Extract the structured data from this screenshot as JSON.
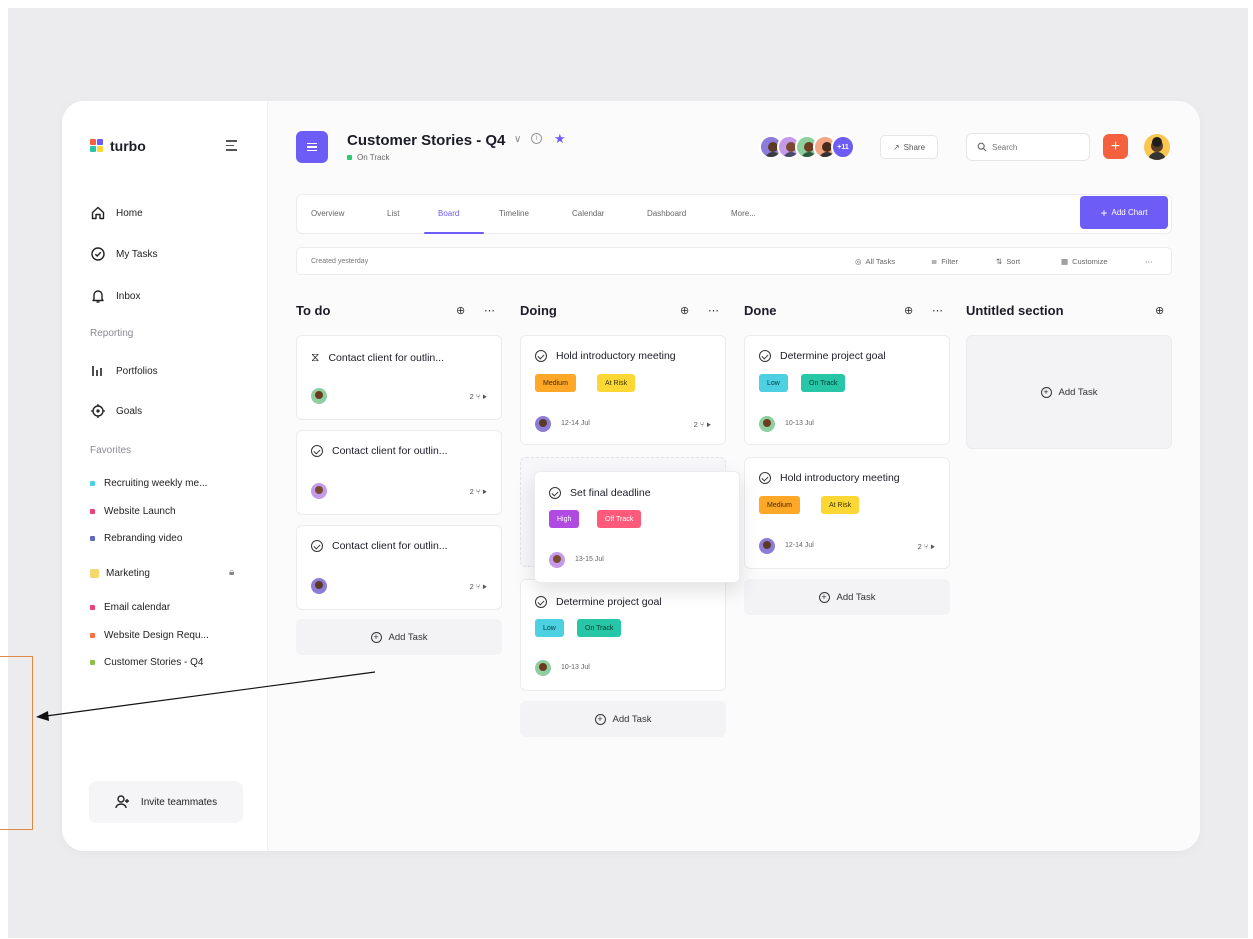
{
  "brand": {
    "name": "turbo"
  },
  "sidebar": {
    "nav": [
      {
        "label": "Home",
        "icon": "home-icon"
      },
      {
        "label": "My Tasks",
        "icon": "check-circle-icon"
      },
      {
        "label": "Inbox",
        "icon": "bell-icon"
      }
    ],
    "reporting_label": "Reporting",
    "reporting": [
      {
        "label": "Portfolios",
        "icon": "bar-chart-icon"
      },
      {
        "label": "Goals",
        "icon": "target-icon"
      }
    ],
    "favorites_label": "Favorites",
    "favorites": [
      {
        "label": "Recruiting weekly me...",
        "color": "#4dd0e1"
      },
      {
        "label": "Website Launch",
        "color": "#ec407a"
      },
      {
        "label": "Rebranding video",
        "color": "#5c6bc0"
      }
    ],
    "folder": {
      "label": "Marketing",
      "color": "#f5d76e"
    },
    "folder_items": [
      {
        "label": "Email calendar",
        "color": "#ec407a"
      },
      {
        "label": "Website Design Requ...",
        "color": "#ff7043"
      },
      {
        "label": "Customer Stories - Q4",
        "color": "#8bc34a"
      }
    ],
    "invite_label": "Invite teammates"
  },
  "header": {
    "title": "Customer Stories - Q4",
    "status": "On Track",
    "status_color": "#2ecc71",
    "avatar_count": "+11",
    "share_label": "Share",
    "search_placeholder": "Search"
  },
  "tabs": [
    "Overview",
    "List",
    "Board",
    "Timeline",
    "Calendar",
    "Dashboard",
    "More..."
  ],
  "active_tab": "Board",
  "add_chart_label": "Add Chart",
  "filter_bar": {
    "created": "Created yesterday",
    "all_tasks": "All Tasks",
    "filter": "Filter",
    "sort": "Sort",
    "customize": "Customize"
  },
  "columns": {
    "todo": {
      "title": "To do",
      "cards": [
        {
          "title": "Contact client for outlin...",
          "meta": "2",
          "icon": "hourglass-icon"
        },
        {
          "title": "Contact client for outlin...",
          "meta": "2"
        },
        {
          "title": "Contact client for outlin...",
          "meta": "2"
        }
      ]
    },
    "doing": {
      "title": "Doing",
      "cards": [
        {
          "title": "Hold introductory meeting",
          "tags": [
            "Medium",
            "At Risk"
          ],
          "date": "12-14 Jul",
          "meta": "2"
        },
        {
          "title": "Set final deadline",
          "tags": [
            "High",
            "Off Track"
          ],
          "date": "13-15 Jul"
        },
        {
          "title": "Determine project goal",
          "tags": [
            "Low",
            "On Track"
          ],
          "date": "10-13 Jul"
        }
      ]
    },
    "done": {
      "title": "Done",
      "cards": [
        {
          "title": "Determine project goal",
          "tags": [
            "Low",
            "On Track"
          ],
          "date": "10-13 Jul"
        },
        {
          "title": "Hold introductory meeting",
          "tags": [
            "Medium",
            "At Risk"
          ],
          "date": "12-14 Jul",
          "meta": "2"
        }
      ]
    },
    "untitled": {
      "title": "Untitled section"
    }
  },
  "add_task_label": "Add Task",
  "tag_colors": {
    "Medium": "#ffa726",
    "At Risk": "#fdd835",
    "Low": "#4dd0e1",
    "On Track": "#26c6a6",
    "High": "#b04ae0",
    "Off Track": "#ff5a7a"
  }
}
